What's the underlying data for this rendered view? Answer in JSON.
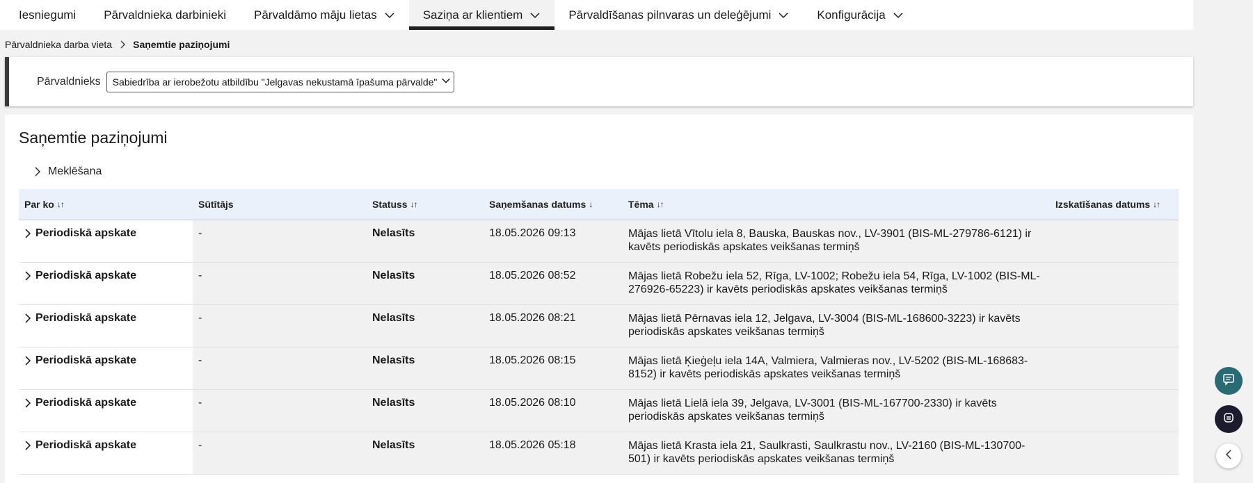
{
  "nav": {
    "items": [
      {
        "label": "Iesniegumi",
        "has_dropdown": false,
        "active": false
      },
      {
        "label": "Pārvaldnieka darbinieki",
        "has_dropdown": false,
        "active": false
      },
      {
        "label": "Pārvaldāmo māju lietas",
        "has_dropdown": true,
        "active": false
      },
      {
        "label": "Saziņa ar klientiem",
        "has_dropdown": true,
        "active": true
      },
      {
        "label": "Pārvaldīšanas pilnvaras un deleģējumi",
        "has_dropdown": true,
        "active": false
      },
      {
        "label": "Konfigurācija",
        "has_dropdown": true,
        "active": false
      }
    ]
  },
  "breadcrumb": {
    "parent": "Pārvaldnieka darba vieta",
    "current": "Saņemtie paziņojumi"
  },
  "manager": {
    "label": "Pārvaldnieks",
    "selected": "Sabiedrība ar ierobežotu atbildību \"Jelgavas nekustamā īpašuma pārvalde\""
  },
  "page": {
    "title": "Saņemtie paziņojumi",
    "search_label": "Meklēšana"
  },
  "table": {
    "columns": [
      {
        "label": "Par ko",
        "sort": "↓↑"
      },
      {
        "label": "Sūtītājs",
        "sort": ""
      },
      {
        "label": "Statuss",
        "sort": "↓↑"
      },
      {
        "label": "Saņemšanas datums",
        "sort": "↓"
      },
      {
        "label": "Tēma",
        "sort": "↓↑"
      },
      {
        "label": "Izskatīšanas datums",
        "sort": "↓↑"
      }
    ],
    "rows": [
      {
        "subject": "Periodiskā apskate",
        "sender": "-",
        "status": "Nelasīts",
        "received": "18.05.2026 09:13",
        "theme": "Mājas lietā Vītolu iela 8, Bauska, Bauskas nov., LV-3901 (BIS-ML-279786-6121) ir kavēts periodiskās apskates veikšanas termiņš",
        "reviewed": ""
      },
      {
        "subject": "Periodiskā apskate",
        "sender": "-",
        "status": "Nelasīts",
        "received": "18.05.2026 08:52",
        "theme": "Mājas lietā Robežu iela 52, Rīga, LV-1002; Robežu iela 54, Rīga, LV-1002 (BIS-ML-276926-65223) ir kavēts periodiskās apskates veikšanas termiņš",
        "reviewed": ""
      },
      {
        "subject": "Periodiskā apskate",
        "sender": "-",
        "status": "Nelasīts",
        "received": "18.05.2026 08:21",
        "theme": "Mājas lietā Pērnavas iela 12, Jelgava, LV-3004 (BIS-ML-168600-3223) ir kavēts periodiskās apskates veikšanas termiņš",
        "reviewed": ""
      },
      {
        "subject": "Periodiskā apskate",
        "sender": "-",
        "status": "Nelasīts",
        "received": "18.05.2026 08:15",
        "theme": "Mājas lietā Ķieģeļu iela 14A, Valmiera, Valmieras nov., LV-5202 (BIS-ML-168683-8152) ir kavēts periodiskās apskates veikšanas termiņš",
        "reviewed": ""
      },
      {
        "subject": "Periodiskā apskate",
        "sender": "-",
        "status": "Nelasīts",
        "received": "18.05.2026 08:10",
        "theme": "Mājas lietā Lielā iela 39, Jelgava, LV-3001 (BIS-ML-167700-2330) ir kavēts periodiskās apskates veikšanas termiņš",
        "reviewed": ""
      },
      {
        "subject": "Periodiskā apskate",
        "sender": "-",
        "status": "Nelasīts",
        "received": "18.05.2026 05:18",
        "theme": "Mājas lietā Krasta iela 21, Saulkrasti, Saulkrastu nov., LV-2160 (BIS-ML-130700-501) ir kavēts periodiskās apskates veikšanas termiņš",
        "reviewed": ""
      }
    ]
  },
  "icons": {
    "chat": "chat-icon",
    "bot": "bot-icon",
    "collapse": "chevron-left-icon"
  },
  "colors": {
    "chat_button": "#2a6b73",
    "bot_button": "#1c1c2e",
    "header_row": "#eaf1fa"
  }
}
